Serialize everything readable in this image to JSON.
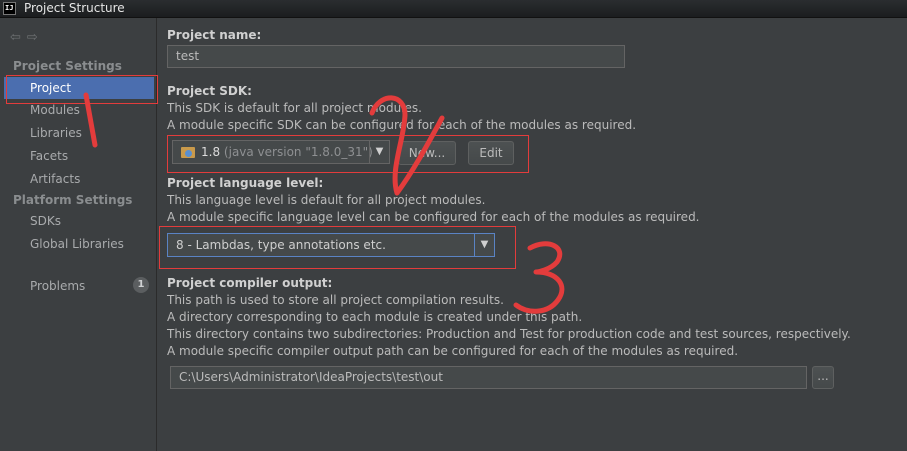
{
  "window": {
    "title": "Project Structure",
    "app_icon_text": "IJ"
  },
  "sidebar": {
    "back_icon": "arrow-left-icon",
    "forward_icon": "arrow-right-icon",
    "project_settings_header": "Project Settings",
    "project_settings_items": [
      "Project",
      "Modules",
      "Libraries",
      "Facets",
      "Artifacts"
    ],
    "platform_settings_header": "Platform Settings",
    "platform_settings_items": [
      "SDKs",
      "Global Libraries"
    ],
    "problems_label": "Problems",
    "problems_count": "1",
    "selected": "Project"
  },
  "main": {
    "project_name_label": "Project name:",
    "project_name_value": "test",
    "sdk_label": "Project SDK:",
    "sdk_desc1": "This SDK is default for all project modules.",
    "sdk_desc2": "A module specific SDK can be configured for each of the modules as required.",
    "sdk_version": "1.8",
    "sdk_detail": "(java version \"1.8.0_31\")",
    "new_button": "New...",
    "edit_button": "Edit",
    "lang_label": "Project language level:",
    "lang_desc1": "This language level is default for all project modules.",
    "lang_desc2": "A module specific language level can be configured for each of the modules as required.",
    "lang_value": "8 - Lambdas, type annotations etc.",
    "output_label": "Project compiler output:",
    "output_desc1": "This path is used to store all project compilation results.",
    "output_desc2": "A directory corresponding to each module is created under this path.",
    "output_desc3": "This directory contains two subdirectories: Production and Test for production code and test sources, respectively.",
    "output_desc4": "A module specific compiler output path can be configured for each of the modules as required.",
    "output_path": "C:\\Users\\Administrator\\IdeaProjects\\test\\out",
    "browse_button": "..."
  },
  "annotations": {
    "mark_1": "1",
    "mark_2": "2",
    "mark_3": "3",
    "color": "#e33c3c"
  }
}
